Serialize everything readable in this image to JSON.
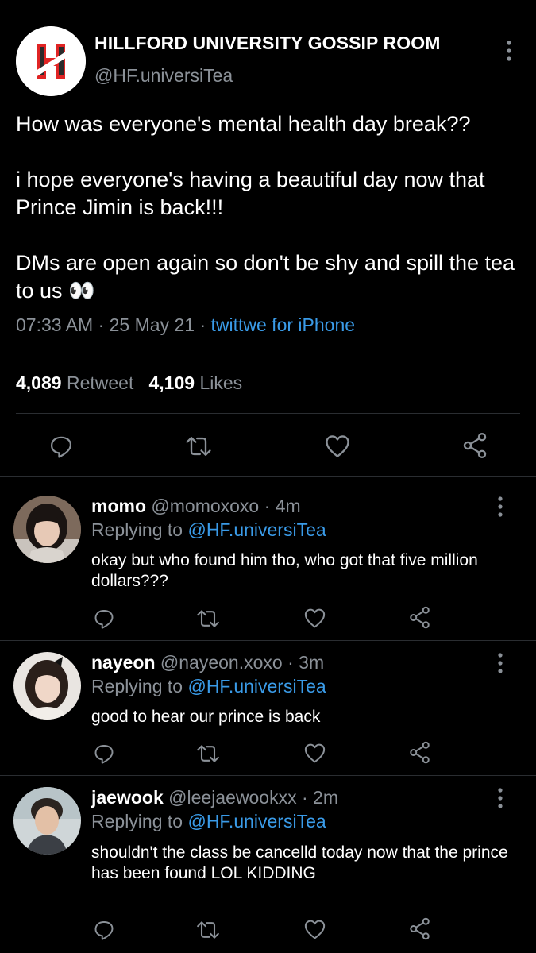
{
  "account": {
    "name": "HILLFORD UNIVERSITY GOSSIP ROOM",
    "handle": "@HF.universiTea",
    "logo_letter": "H"
  },
  "tweet": {
    "text": "How was everyone's mental health day break??\n\ni hope everyone's having a beautiful day now that Prince Jimin is back!!!\n\nDMs are open again so don't be shy and spill the tea to us 👀",
    "time": "07:33 AM",
    "sep1": "·",
    "date": "25 May 21",
    "sep2": "·",
    "source": "twittwe for iPhone",
    "retweets_count": "4,089",
    "retweets_label": "Retweet",
    "likes_count": "4,109",
    "likes_label": "Likes"
  },
  "icons": {
    "reply": "comment-icon",
    "retweet": "retweet-icon",
    "like": "heart-icon",
    "share": "share-icon",
    "more": "more-vertical-icon"
  },
  "colors": {
    "background": "#000000",
    "link": "#3a9be8",
    "muted": "#8b9198",
    "logo_red": "#e02424"
  },
  "replies": [
    {
      "name": "momo",
      "handle": "@momoxoxo",
      "sep": "·",
      "time": "4m",
      "replying_prefix": "Replying to",
      "replying_to": "@HF.universiTea",
      "text": "okay but who found him tho, who got that five million dollars???"
    },
    {
      "name": "nayeon",
      "handle": "@nayeon.xoxo",
      "sep": "·",
      "time": "3m",
      "replying_prefix": "Replying to",
      "replying_to": "@HF.universiTea",
      "text": "good to hear our prince is back"
    },
    {
      "name": "jaewook",
      "handle": "@leejaewookxx",
      "sep": "·",
      "time": "2m",
      "replying_prefix": "Replying to",
      "replying_to": "@HF.universiTea",
      "text": "shouldn't the class be cancelld today now that the prince has been found LOL KIDDING"
    }
  ]
}
